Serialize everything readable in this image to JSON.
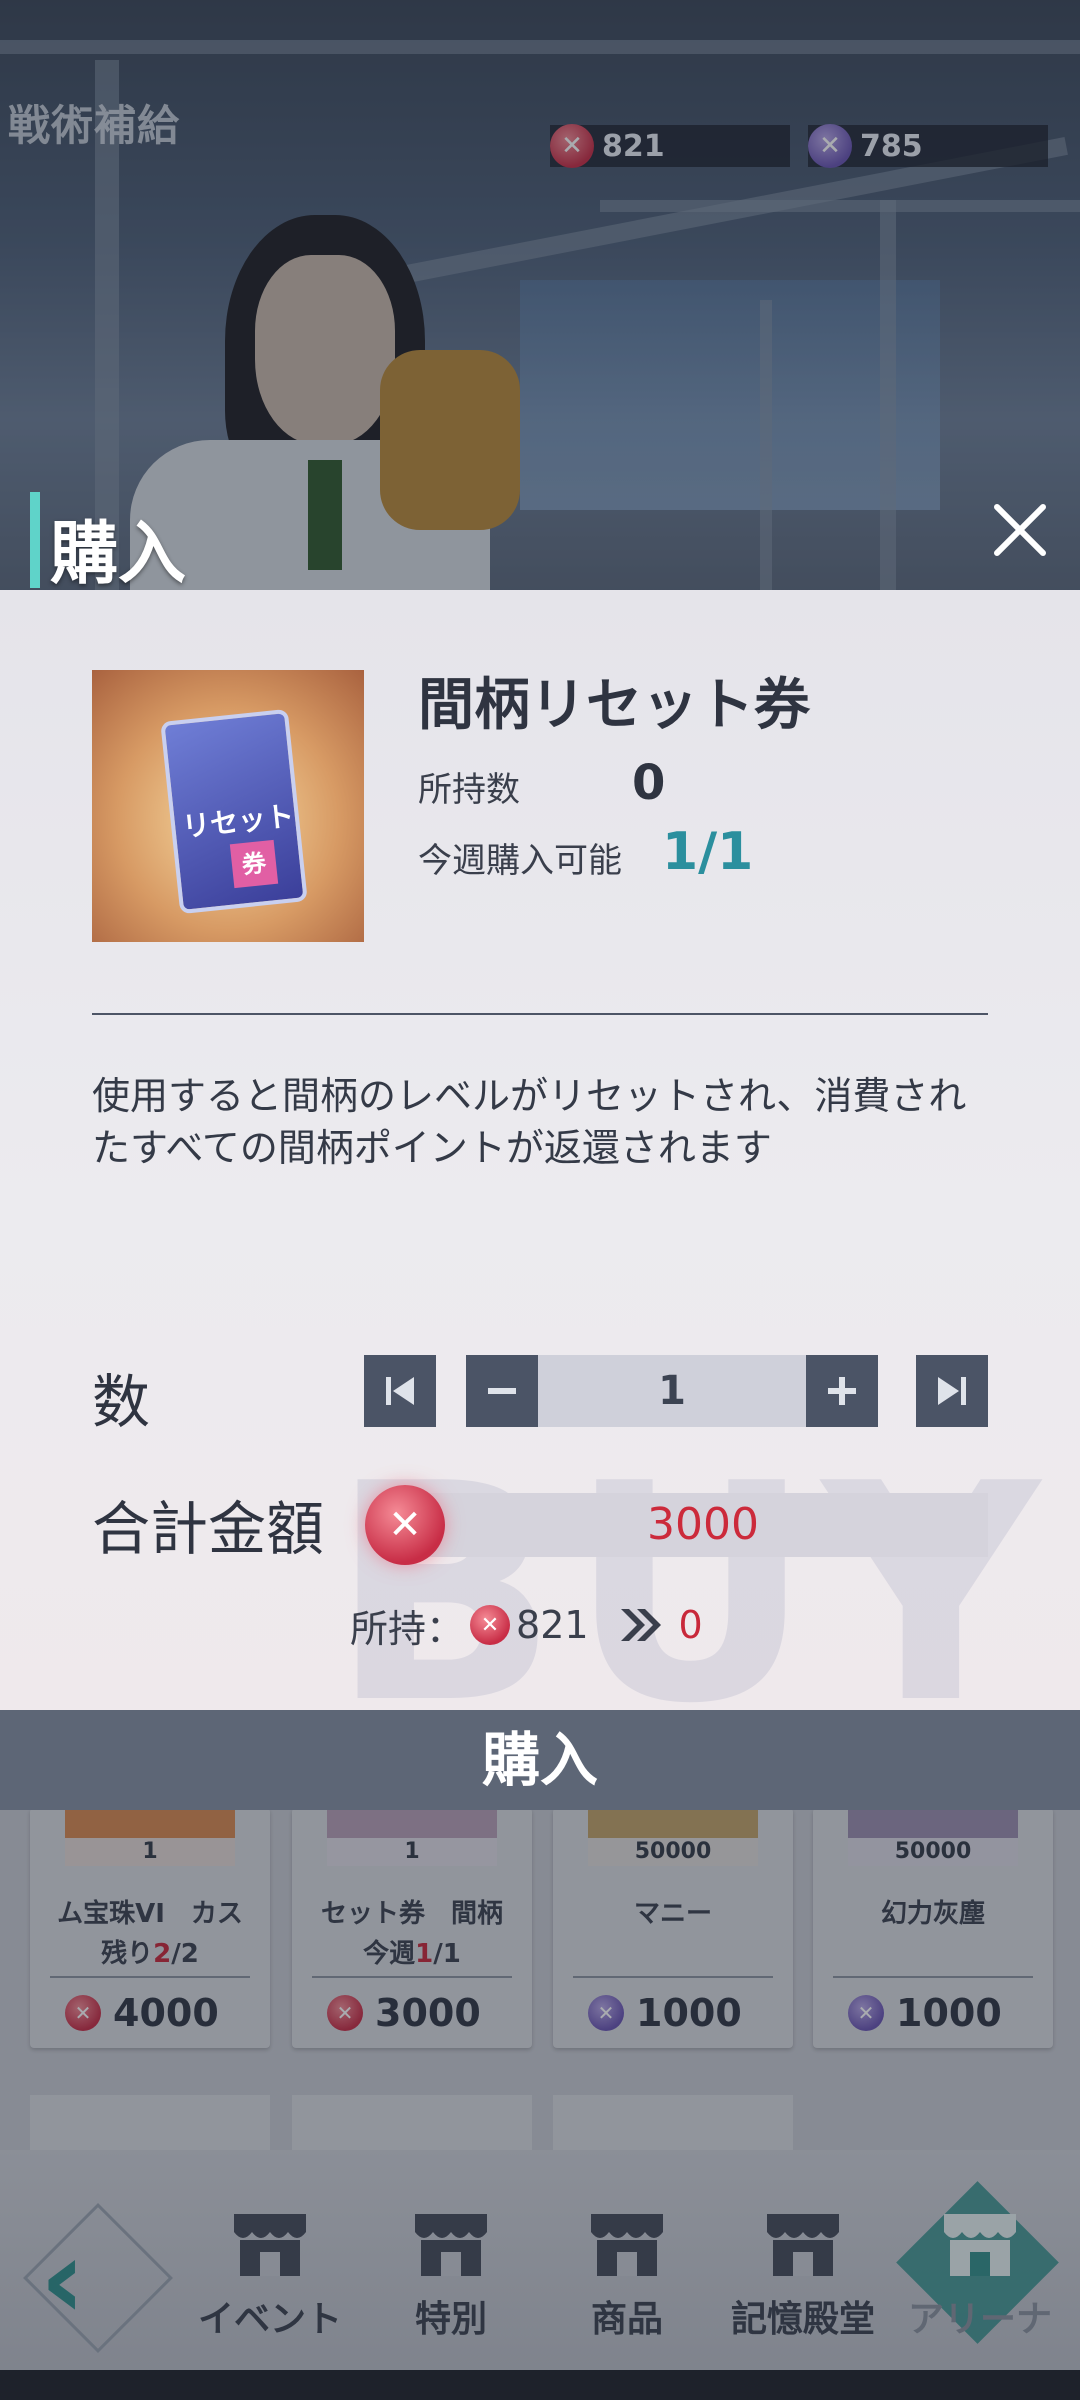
{
  "background": {
    "screen_title": "戦術補給",
    "currencies": [
      {
        "icon": "red-crystal-icon",
        "value": "821"
      },
      {
        "icon": "purple-crystal-icon",
        "value": "785"
      }
    ]
  },
  "shop": {
    "cards": [
      {
        "name": "ム宝珠VI　カス",
        "qty": "1",
        "limit_prefix": "残り",
        "limit_current": "2",
        "limit_total": "/2",
        "price": "4000",
        "currency": "red"
      },
      {
        "name": "セット券　間柄",
        "qty": "1",
        "limit_prefix": "今週",
        "limit_current": "1",
        "limit_total": "/1",
        "price": "3000",
        "currency": "red"
      },
      {
        "name": "マニー",
        "qty": "50000",
        "limit_prefix": "",
        "limit_current": "",
        "limit_total": "",
        "price": "1000",
        "currency": "purple"
      },
      {
        "name": "幻力灰塵",
        "qty": "50000",
        "limit_prefix": "",
        "limit_current": "",
        "limit_total": "",
        "price": "1000",
        "currency": "purple"
      }
    ]
  },
  "nav": {
    "items": [
      {
        "label": "イベント"
      },
      {
        "label": "特別"
      },
      {
        "label": "商品"
      },
      {
        "label": "記憶殿堂"
      },
      {
        "label": "アリーナ"
      }
    ]
  },
  "modal": {
    "title": "購入",
    "item": {
      "name": "間柄リセット券",
      "icon_label": "リセット",
      "icon_badge": "券",
      "owned_label": "所持数",
      "owned_value": "0",
      "weekly_label": "今週購入可能",
      "weekly_value": "1/1",
      "description": "使用すると間柄のレベルがリセットされ、消費されたすべての間柄ポイントが返還されます"
    },
    "quantity": {
      "label": "数",
      "value": "1"
    },
    "total": {
      "label": "合計金額",
      "value": "3000"
    },
    "holdings": {
      "label": "所持：",
      "gem_value": "821",
      "other_value": "0"
    },
    "watermark": "BUY",
    "buy_label": "購入"
  },
  "colors": {
    "accent": "#5fd3c9",
    "price_red": "#cc2a3b",
    "weekly_teal": "#2b8f9e",
    "buy_button": "#5d6676"
  }
}
